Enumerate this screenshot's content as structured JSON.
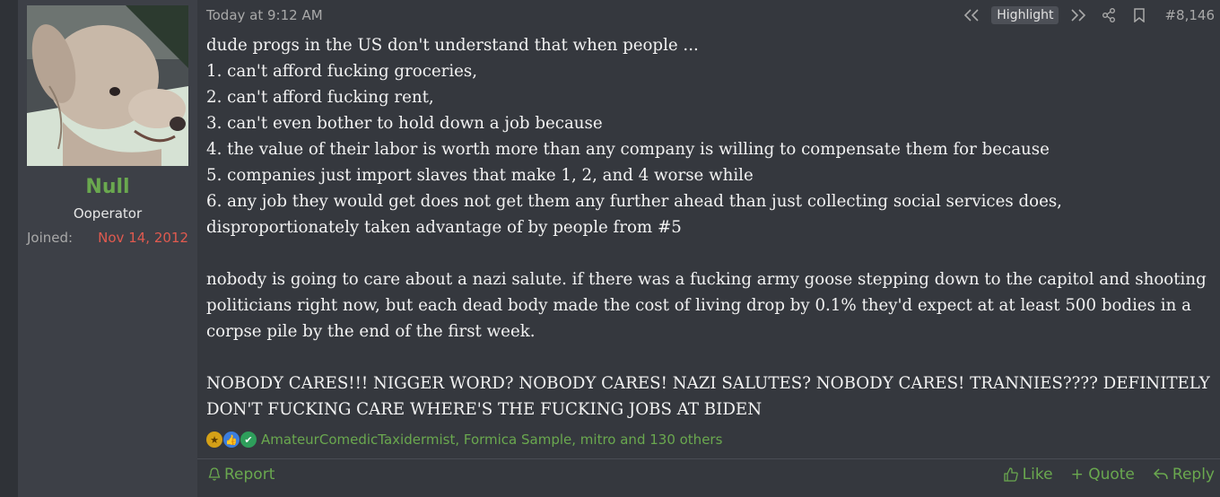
{
  "user": {
    "name": "Null",
    "title": "Ooperator",
    "joined_label": "Joined:",
    "joined_date": "Nov 14, 2012",
    "avatar_icon": "dog-avatar"
  },
  "post": {
    "timestamp": "Today at 9:12 AM",
    "highlight_label": "Highlight",
    "post_number": "#8,146",
    "lines": [
      "dude progs in the US don't understand that when people ...",
      "1. can't afford fucking groceries,",
      "2. can't afford fucking rent,",
      "3. can't even bother to hold down a job because",
      "4. the value of their labor is worth more than any company is willing to compensate them for because",
      "5. companies just import slaves that make 1, 2, and 4 worse while",
      "6. any job they would get does not get them any further ahead than just collecting social services does, disproportionately taken advantage of by people from #5"
    ],
    "paragraph2": "nobody is going to care about a nazi salute. if there was a fucking army goose stepping down to the capitol and shooting politicians right now, but each dead body made the cost of living drop by 0.1% they'd expect at at least 500 bodies in a corpse pile by the end of the first week.",
    "paragraph3": "NOBODY CARES!!! NIGGER WORD? NOBODY CARES! NAZI SALUTES? NOBODY CARES! TRANNIES???? DEFINITELY DON'T FUCKING CARE WHERE'S THE FUCKING JOBS AT BIDEN",
    "reactions_text": "AmateurComedicTaxidermist, Formica Sample, mitro and 130 others"
  },
  "actions": {
    "report": "Report",
    "like": "Like",
    "quote": "+ Quote",
    "reply": "Reply"
  },
  "colors": {
    "accent": "#6aa84f",
    "joined_date": "#e05a4f",
    "background": "#35383e",
    "sidebar": "#3d4047"
  }
}
